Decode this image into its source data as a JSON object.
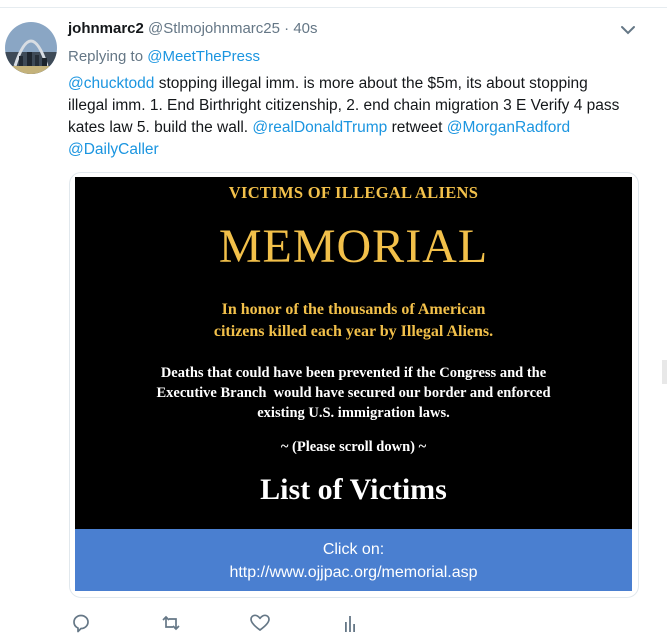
{
  "tweet": {
    "author_name": "johnmarc2",
    "author_handle": "@Stlmojohnmarc25",
    "separator": "·",
    "time": "40s",
    "replying_prefix": "Replying to ",
    "replying_handle": "@MeetThePress",
    "text": {
      "mention1": "@chucktodd",
      "body": " stopping illegal imm. is more about the $5m, its about stopping illegal imm. 1. End Birthright citizenship, 2. end chain migration 3 E Verify 4 pass kates law 5. build the wall. ",
      "mention2": "@realDonaldTrump",
      "mid": " retweet ",
      "mention3": "@MorganRadford",
      "mention4": "@DailyCaller"
    }
  },
  "card": {
    "poster": {
      "heading": "VICTIMS OF ILLEGAL ALIENS",
      "title": "MEMORIAL",
      "honor_line1": "In honor of the thousands of American",
      "honor_line2": "citizens killed each year by Illegal Aliens.",
      "deaths_line1": "Deaths that could have been prevented if the Congress and the",
      "deaths_line2": "Executive Branch  would have secured our border and enforced",
      "deaths_line3": "existing U.S. immigration laws.",
      "scroll_note": "~ (Please scroll down) ~",
      "list_title": "List of Victims"
    },
    "banner": {
      "line1": "Click on:",
      "line2": "http://www.ojjpac.org/memorial.asp"
    }
  },
  "icons": {
    "more": "chevron-down-icon",
    "reply": "reply-icon",
    "retweet": "retweet-icon",
    "like": "heart-icon",
    "analytics": "analytics-icon"
  },
  "colors": {
    "link": "#1b95e0",
    "muted": "#657786",
    "poster_gold": "#f2c04a",
    "banner_blue": "#4a7fd0"
  }
}
